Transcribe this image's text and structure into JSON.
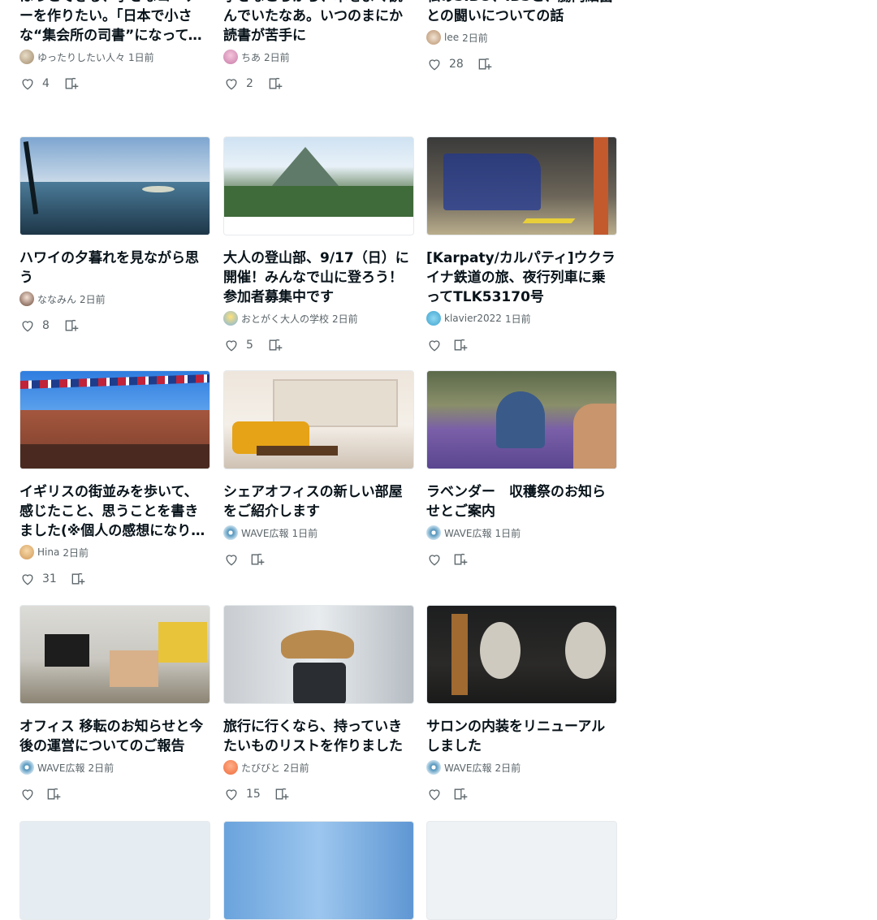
{
  "cards": [
    {
      "title": "ほっとできる、小さなコーナーを作りたい。「日本で小さな“集会所の司書”になって、本と人がつながる場所をつくる」という夢",
      "author": "ゆったりしたい人々",
      "time": "1日前",
      "likes": "4"
    },
    {
      "title": "小さなころから、本をよく読んでいたなあ。いつのまにか読書が苦手に",
      "author": "ちあ",
      "time": "2日前",
      "likes": "2"
    },
    {
      "title": "私のSIBO、IBSと、腸内細菌との闘いについての話",
      "author": "lee",
      "time": "2日前",
      "likes": "28"
    },
    {
      "title": "ハワイの夕暮れを見ながら思う",
      "author": "ななみん",
      "time": "2日前",
      "likes": "8"
    },
    {
      "title": "大人の登山部、9/17（日）に開催！みんなで山に登ろう！参加者募集中です",
      "author": "おとがく大人の学校",
      "time": "2日前",
      "likes": "5"
    },
    {
      "title": "[Karpaty/カルパティ]ウクライナ鉄道の旅、夜行列車に乗ってTLK53170号",
      "author": "klavier2022",
      "time": "1日前",
      "likes": ""
    },
    {
      "title": "イギリスの街並みを歩いて、感じたこと、思うことを書きました(※個人の感想になります)",
      "author": "Hina",
      "time": "2日前",
      "likes": "31"
    },
    {
      "title": "シェアオフィスの新しい部屋をご紹介します",
      "author": "WAVE広報",
      "time": "1日前",
      "likes": ""
    },
    {
      "title": "ラベンダー　収穫祭のお知らせとご案内",
      "author": "WAVE広報",
      "time": "1日前",
      "likes": ""
    },
    {
      "title": "オフィス 移転のお知らせと今後の運営についてのご報告",
      "author": "WAVE広報",
      "time": "2日前",
      "likes": ""
    },
    {
      "title": "旅行に行くなら、持っていきたいものリストを作りました",
      "author": "たびびと",
      "time": "2日前",
      "likes": "15"
    },
    {
      "title": "サロンの内装をリニューアルしました",
      "author": "WAVE広報",
      "time": "2日前",
      "likes": ""
    }
  ],
  "icons": {
    "like": "heart-outline-icon",
    "magazine": "magazine-add-icon"
  },
  "colors": {
    "text": "#08131a",
    "sub": "#5a6469",
    "border": "#e6eaed"
  }
}
